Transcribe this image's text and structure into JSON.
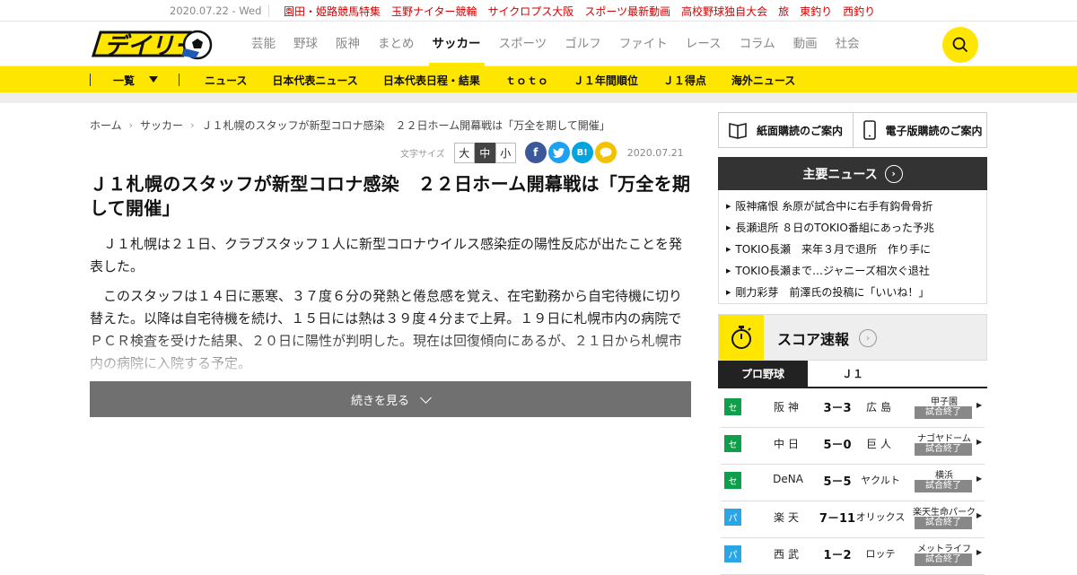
{
  "topbar": {
    "date": "2020.07.22 - Wed",
    "links": [
      "園田・姫路競馬特集",
      "玉野ナイター競輪",
      "サイクロプス大阪",
      "スポーツ最新動画",
      "高校野球独自大会",
      "旅",
      "東釣り",
      "西釣り"
    ]
  },
  "header": {
    "nav": [
      "芸能",
      "野球",
      "阪神",
      "まとめ",
      "サッカー",
      "スポーツ",
      "ゴルフ",
      "ファイト",
      "レース",
      "コラム",
      "動画",
      "社会"
    ],
    "active_nav": "サッカー"
  },
  "subnav": {
    "list_label": "一覧",
    "items": [
      "ニュース",
      "日本代表ニュース",
      "日本代表日程・結果",
      "ｔｏｔｏ",
      "Ｊ１年間順位",
      "Ｊ１得点",
      "海外ニュース"
    ]
  },
  "breadcrumb": [
    "ホーム",
    "サッカー",
    "Ｊ１札幌のスタッフが新型コロナ感染　２２日ホーム開幕戦は「万全を期して開催」"
  ],
  "article": {
    "font_size_label": "文字サイズ",
    "sizes": [
      "大",
      "中",
      "小"
    ],
    "selected_size": "中",
    "date": "2020.07.21",
    "headline": "Ｊ１札幌のスタッフが新型コロナ感染　２２日ホーム開幕戦は「万全を期して開催」",
    "paragraphs": [
      "Ｊ１札幌は２１日、クラブスタッフ１人に新型コロナウイルス感染症の陽性反応が出たことを発表した。",
      "このスタッフは１４日に悪寒、３７度６分の発熱と倦怠感を覚え、在宅勤務から自宅待機に切り替えた。以降は自宅待機を続け、１５日には熱は３９度４分まで上昇。１９日に札幌市内の病院でＰＣＲ検査を受けた結果、２０日に陽性が判明した。現在は回復傾向にあるが、２１日から札幌市内の病院に入院する予定。"
    ],
    "more_label": "続きを見る",
    "share_icons": [
      "facebook-icon",
      "twitter-icon",
      "hatena-bookmark-icon",
      "line-icon"
    ]
  },
  "sidebar": {
    "subscribe_paper": "紙面購読のご案内",
    "subscribe_digital": "電子版購読のご案内",
    "news_title": "主要ニュース",
    "news": [
      "阪神痛恨 糸原が試合中に右手有鈎骨骨折",
      "長瀬退所 ８日のTOKIO番組にあった予兆",
      "TOKIO長瀬　来年３月で退所　作り手に",
      "TOKIO長瀬まで…ジャニーズ相次ぐ退社",
      "剛力彩芽　前澤氏の投稿に「いいね！」"
    ],
    "score_title": "スコア速報",
    "score_tabs": [
      "プロ野球",
      "Ｊ１"
    ],
    "games": [
      {
        "league": "セ",
        "home": "阪神",
        "score": "3－3",
        "away": "広島",
        "venue": "甲子園",
        "status": "試合終了"
      },
      {
        "league": "セ",
        "home": "中日",
        "score": "5－0",
        "away": "巨人",
        "venue": "ナゴヤドーム",
        "status": "試合終了"
      },
      {
        "league": "セ",
        "home": "DeNA",
        "score": "5－5",
        "away": "ヤクルト",
        "venue": "横浜",
        "status": "試合終了"
      },
      {
        "league": "パ",
        "home": "楽天",
        "score": "7－11",
        "away": "オリックス",
        "venue": "楽天生命パーク",
        "status": "試合終了"
      },
      {
        "league": "パ",
        "home": "西武",
        "score": "1－2",
        "away": "ロッテ",
        "venue": "メットライフ",
        "status": "試合終了"
      }
    ]
  },
  "colors": {
    "brand_yellow": "#ffe600",
    "link_red": "#d20000",
    "central_league": "#0f9e4a",
    "pacific_league": "#2aa6e6"
  }
}
